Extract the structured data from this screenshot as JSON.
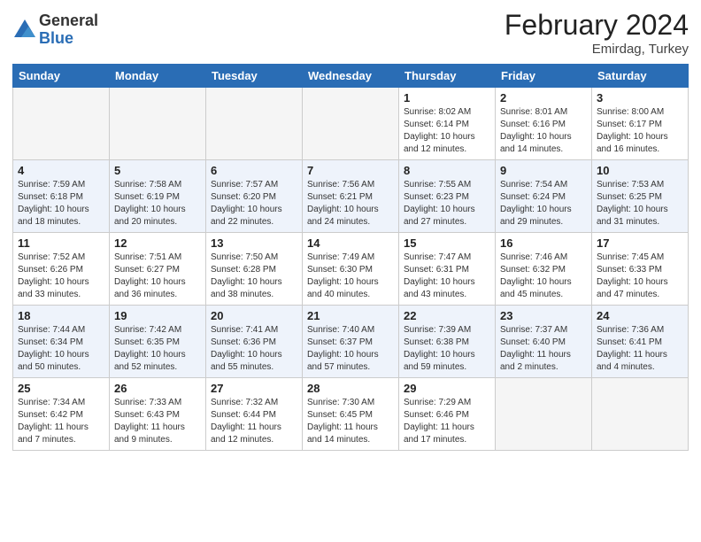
{
  "header": {
    "logo_general": "General",
    "logo_blue": "Blue",
    "month_title": "February 2024",
    "location": "Emirdag, Turkey"
  },
  "weekdays": [
    "Sunday",
    "Monday",
    "Tuesday",
    "Wednesday",
    "Thursday",
    "Friday",
    "Saturday"
  ],
  "weeks": [
    [
      {
        "day": "",
        "info": ""
      },
      {
        "day": "",
        "info": ""
      },
      {
        "day": "",
        "info": ""
      },
      {
        "day": "",
        "info": ""
      },
      {
        "day": "1",
        "info": "Sunrise: 8:02 AM\nSunset: 6:14 PM\nDaylight: 10 hours\nand 12 minutes."
      },
      {
        "day": "2",
        "info": "Sunrise: 8:01 AM\nSunset: 6:16 PM\nDaylight: 10 hours\nand 14 minutes."
      },
      {
        "day": "3",
        "info": "Sunrise: 8:00 AM\nSunset: 6:17 PM\nDaylight: 10 hours\nand 16 minutes."
      }
    ],
    [
      {
        "day": "4",
        "info": "Sunrise: 7:59 AM\nSunset: 6:18 PM\nDaylight: 10 hours\nand 18 minutes."
      },
      {
        "day": "5",
        "info": "Sunrise: 7:58 AM\nSunset: 6:19 PM\nDaylight: 10 hours\nand 20 minutes."
      },
      {
        "day": "6",
        "info": "Sunrise: 7:57 AM\nSunset: 6:20 PM\nDaylight: 10 hours\nand 22 minutes."
      },
      {
        "day": "7",
        "info": "Sunrise: 7:56 AM\nSunset: 6:21 PM\nDaylight: 10 hours\nand 24 minutes."
      },
      {
        "day": "8",
        "info": "Sunrise: 7:55 AM\nSunset: 6:23 PM\nDaylight: 10 hours\nand 27 minutes."
      },
      {
        "day": "9",
        "info": "Sunrise: 7:54 AM\nSunset: 6:24 PM\nDaylight: 10 hours\nand 29 minutes."
      },
      {
        "day": "10",
        "info": "Sunrise: 7:53 AM\nSunset: 6:25 PM\nDaylight: 10 hours\nand 31 minutes."
      }
    ],
    [
      {
        "day": "11",
        "info": "Sunrise: 7:52 AM\nSunset: 6:26 PM\nDaylight: 10 hours\nand 33 minutes."
      },
      {
        "day": "12",
        "info": "Sunrise: 7:51 AM\nSunset: 6:27 PM\nDaylight: 10 hours\nand 36 minutes."
      },
      {
        "day": "13",
        "info": "Sunrise: 7:50 AM\nSunset: 6:28 PM\nDaylight: 10 hours\nand 38 minutes."
      },
      {
        "day": "14",
        "info": "Sunrise: 7:49 AM\nSunset: 6:30 PM\nDaylight: 10 hours\nand 40 minutes."
      },
      {
        "day": "15",
        "info": "Sunrise: 7:47 AM\nSunset: 6:31 PM\nDaylight: 10 hours\nand 43 minutes."
      },
      {
        "day": "16",
        "info": "Sunrise: 7:46 AM\nSunset: 6:32 PM\nDaylight: 10 hours\nand 45 minutes."
      },
      {
        "day": "17",
        "info": "Sunrise: 7:45 AM\nSunset: 6:33 PM\nDaylight: 10 hours\nand 47 minutes."
      }
    ],
    [
      {
        "day": "18",
        "info": "Sunrise: 7:44 AM\nSunset: 6:34 PM\nDaylight: 10 hours\nand 50 minutes."
      },
      {
        "day": "19",
        "info": "Sunrise: 7:42 AM\nSunset: 6:35 PM\nDaylight: 10 hours\nand 52 minutes."
      },
      {
        "day": "20",
        "info": "Sunrise: 7:41 AM\nSunset: 6:36 PM\nDaylight: 10 hours\nand 55 minutes."
      },
      {
        "day": "21",
        "info": "Sunrise: 7:40 AM\nSunset: 6:37 PM\nDaylight: 10 hours\nand 57 minutes."
      },
      {
        "day": "22",
        "info": "Sunrise: 7:39 AM\nSunset: 6:38 PM\nDaylight: 10 hours\nand 59 minutes."
      },
      {
        "day": "23",
        "info": "Sunrise: 7:37 AM\nSunset: 6:40 PM\nDaylight: 11 hours\nand 2 minutes."
      },
      {
        "day": "24",
        "info": "Sunrise: 7:36 AM\nSunset: 6:41 PM\nDaylight: 11 hours\nand 4 minutes."
      }
    ],
    [
      {
        "day": "25",
        "info": "Sunrise: 7:34 AM\nSunset: 6:42 PM\nDaylight: 11 hours\nand 7 minutes."
      },
      {
        "day": "26",
        "info": "Sunrise: 7:33 AM\nSunset: 6:43 PM\nDaylight: 11 hours\nand 9 minutes."
      },
      {
        "day": "27",
        "info": "Sunrise: 7:32 AM\nSunset: 6:44 PM\nDaylight: 11 hours\nand 12 minutes."
      },
      {
        "day": "28",
        "info": "Sunrise: 7:30 AM\nSunset: 6:45 PM\nDaylight: 11 hours\nand 14 minutes."
      },
      {
        "day": "29",
        "info": "Sunrise: 7:29 AM\nSunset: 6:46 PM\nDaylight: 11 hours\nand 17 minutes."
      },
      {
        "day": "",
        "info": ""
      },
      {
        "day": "",
        "info": ""
      }
    ]
  ]
}
